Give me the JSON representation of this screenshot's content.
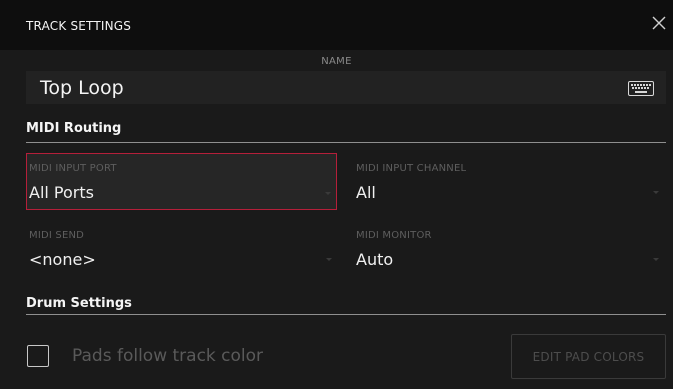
{
  "dialog": {
    "title": "TRACK SETTINGS",
    "close_icon": "close-icon"
  },
  "name": {
    "label": "NAME",
    "value": "Top Loop",
    "keyboard_icon": "keyboard-icon"
  },
  "midi_routing": {
    "header": "MIDI Routing",
    "input_port": {
      "label": "MIDI INPUT PORT",
      "value": "All Ports",
      "selected": true
    },
    "input_channel": {
      "label": "MIDI INPUT CHANNEL",
      "value": "All"
    },
    "send": {
      "label": "MIDI SEND",
      "value": "<none>"
    },
    "monitor": {
      "label": "MIDI MONITOR",
      "value": "Auto"
    }
  },
  "drum_settings": {
    "header": "Drum Settings",
    "pads_follow_label": "Pads follow track color",
    "pads_follow_checked": false,
    "edit_pad_colors_label": "EDIT PAD COLORS"
  },
  "colors": {
    "accent_border": "#b51f3a",
    "background": "#1a1a1a",
    "titlebar": "#0e0e0e"
  }
}
